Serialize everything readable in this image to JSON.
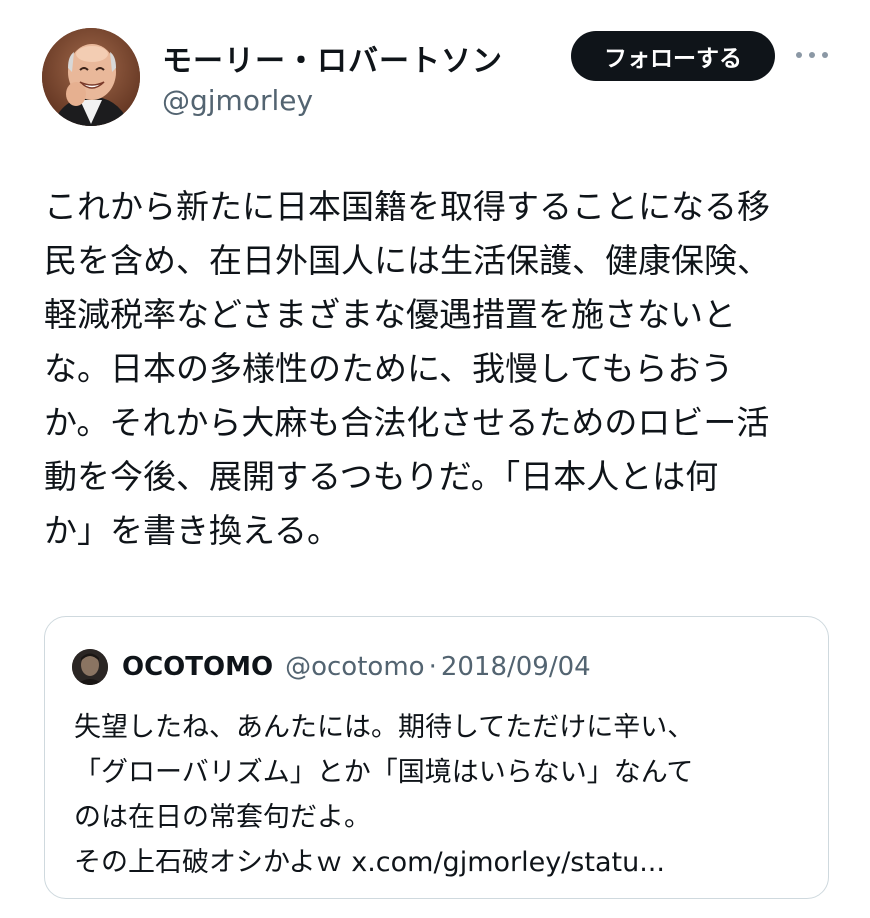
{
  "author": {
    "name": "モーリー・ロバートソン",
    "handle": "@gjmorley"
  },
  "follow_button": {
    "label": "フォローする"
  },
  "more_button": {
    "icon": "more-icon"
  },
  "tweet": {
    "lines": [
      "これから新たに日本国籍を取得することになる移",
      "民を含め、在日外国人には生活保護、健康保険、",
      "軽減税率などさまざまな優遇措置を施さないと",
      "な。日本の多様性のために、我慢してもらおう",
      "か。それから大麻も合法化させるためのロビー活",
      "動を今後、展開するつもりだ。「日本人とは何",
      "か」を書き換える。"
    ]
  },
  "quote": {
    "author_name": "OCOTOMO",
    "handle": "@ocotomo",
    "separator": "·",
    "date": "2018/09/04",
    "lines": [
      "失望したね、あんたには。期待してただけに辛い、",
      "「グローバリズム」とか「国境はいらない」なんて",
      "のは在日の常套句だよ。",
      "その上石破オシかよｗ x.com/gjmorley/statu..."
    ]
  },
  "colors": {
    "text": "#0f1419",
    "secondary": "#536471",
    "button_bg": "#0f1419",
    "button_text": "#ffffff",
    "border": "#cfd9de"
  }
}
